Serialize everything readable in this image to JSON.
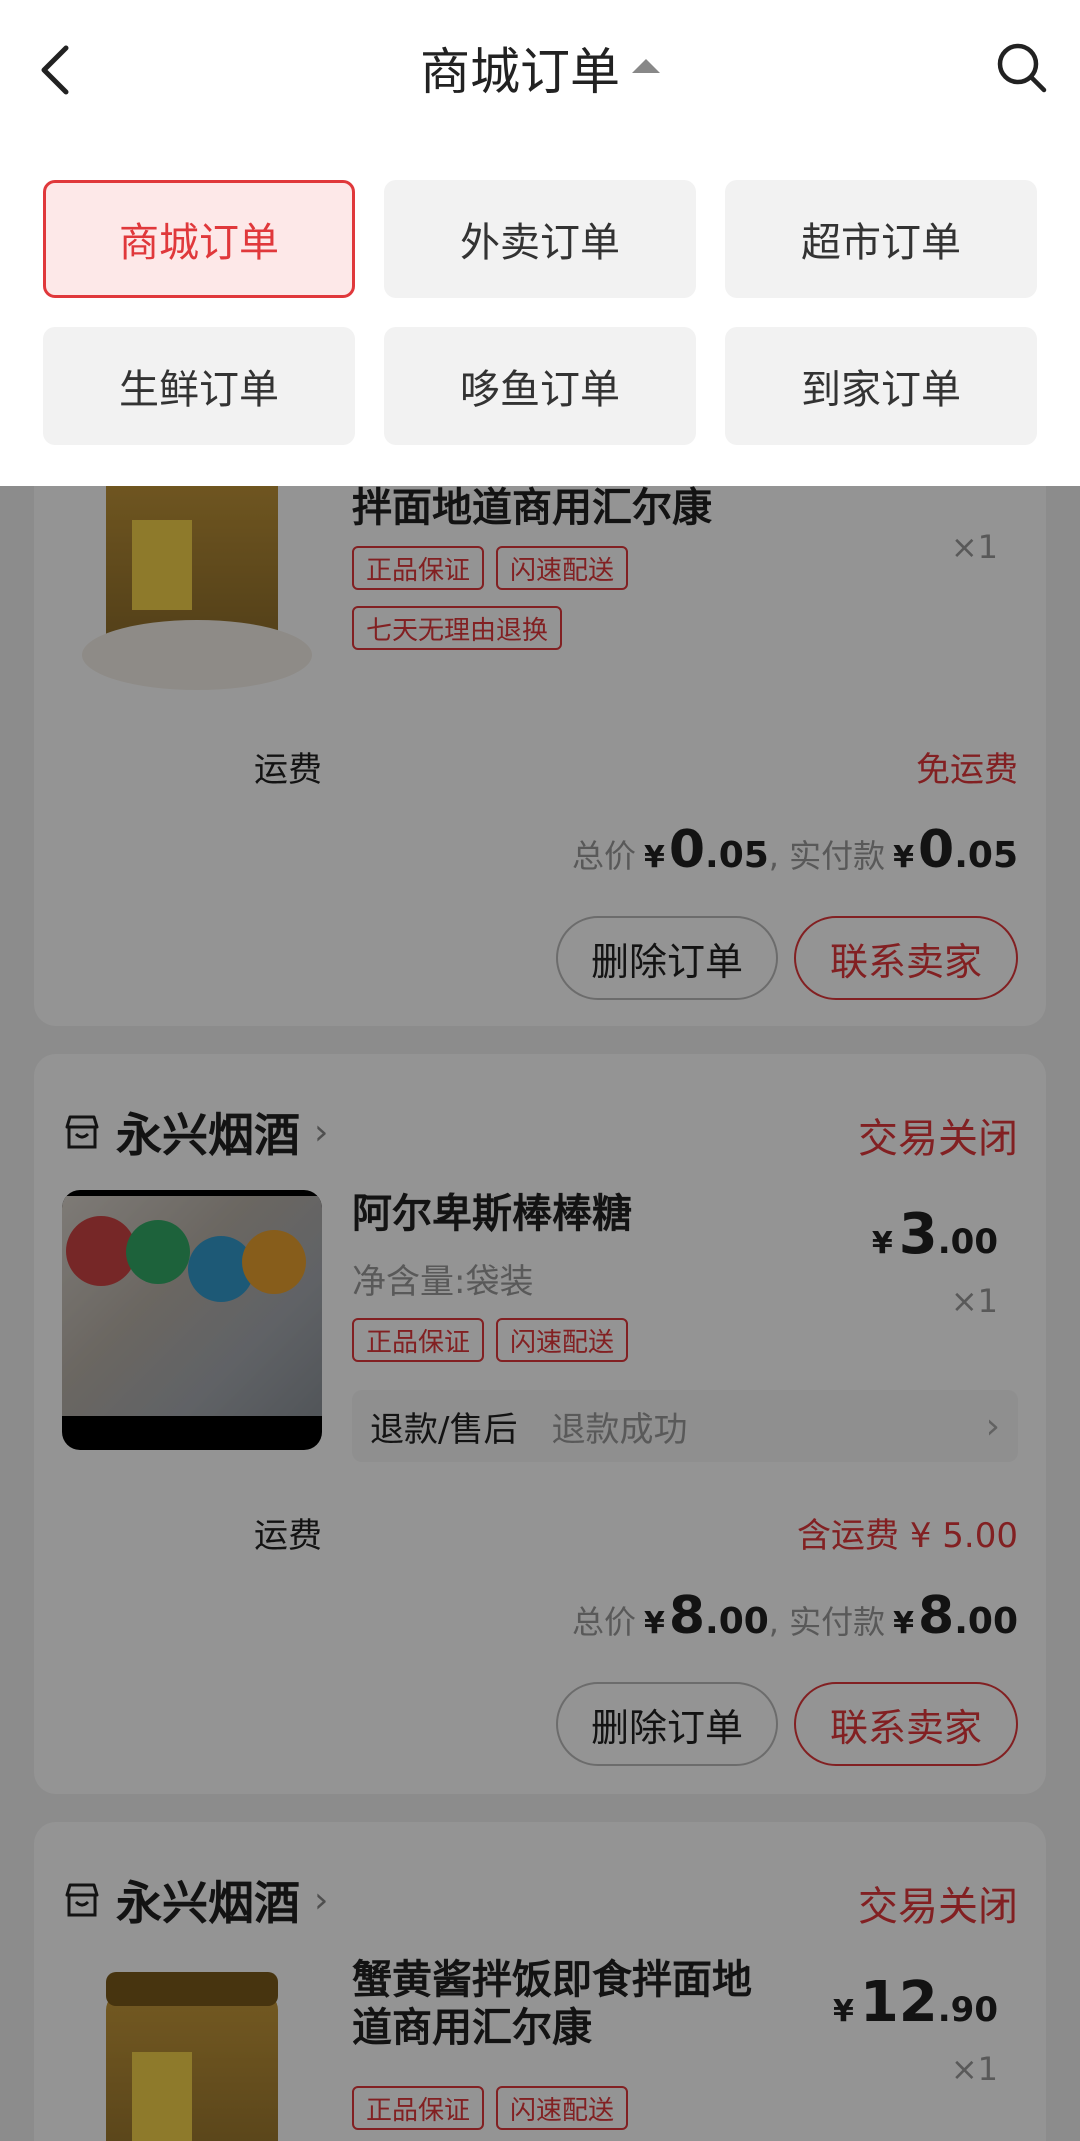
{
  "header": {
    "title": "商城订单"
  },
  "order_types": [
    {
      "label": "商城订单",
      "active": true
    },
    {
      "label": "外卖订单",
      "active": false
    },
    {
      "label": "超市订单",
      "active": false
    },
    {
      "label": "生鲜订单",
      "active": false
    },
    {
      "label": "哆鱼订单",
      "active": false
    },
    {
      "label": "到家订单",
      "active": false
    }
  ],
  "orders": [
    {
      "goods_title": "拌面地道商用汇尔康",
      "price_int": "0",
      "price_dec": ".05",
      "qty": "×1",
      "tags": [
        "正品保证",
        "闪速配送",
        "七天无理由退换"
      ],
      "shipping_label": "运费",
      "shipping_value": "免运费",
      "total_label": "总价",
      "total_int": "0",
      "total_dec": ".05",
      "paid_label": ", 实付款",
      "paid_int": "0",
      "paid_dec": ".05",
      "btn_delete": "删除订单",
      "btn_contact": "联系卖家"
    },
    {
      "shop_name": "永兴烟酒",
      "status": "交易关闭",
      "goods_title": "阿尔卑斯棒棒糖",
      "goods_spec": "净含量:袋装",
      "price_int": "3",
      "price_dec": ".00",
      "qty": "×1",
      "tags": [
        "正品保证",
        "闪速配送"
      ],
      "refund_label": "退款/售后",
      "refund_status": "退款成功",
      "shipping_label": "运费",
      "shipping_value": "含运费 ¥ 5.00",
      "total_label": "总价",
      "total_int": "8",
      "total_dec": ".00",
      "paid_label": ", 实付款",
      "paid_int": "8",
      "paid_dec": ".00",
      "btn_delete": "删除订单",
      "btn_contact": "联系卖家"
    },
    {
      "shop_name": "永兴烟酒",
      "status": "交易关闭",
      "goods_title_line1": "蟹黄酱拌饭即食拌面地",
      "goods_title_line2": "道商用汇尔康",
      "price_int": "12",
      "price_dec": ".90",
      "qty": "×1",
      "tags": [
        "正品保证",
        "闪速配送"
      ]
    }
  ],
  "currency_symbol": "¥",
  "colors": {
    "accent": "#e0383b",
    "overlay": "rgba(0,0,0,0.42)"
  }
}
